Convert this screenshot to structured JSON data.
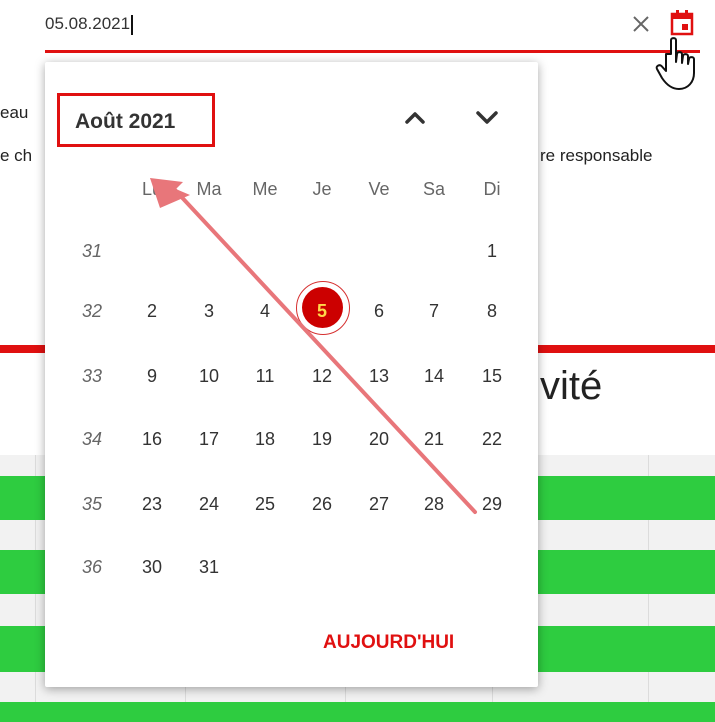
{
  "date_field": {
    "value": "05.08.2021"
  },
  "background": {
    "fragment_1": "eau",
    "fragment_2": "e ch",
    "fragment_3": "re responsable",
    "heading_fragment": "vité"
  },
  "calendar": {
    "month_label": "Août 2021",
    "weekdays": [
      "Lu",
      "Ma",
      "Me",
      "Je",
      "Ve",
      "Sa",
      "Di"
    ],
    "weeks": [
      {
        "number": "31",
        "days": [
          "",
          "",
          "",
          "",
          "",
          "",
          "1"
        ]
      },
      {
        "number": "32",
        "days": [
          "2",
          "3",
          "4",
          "5",
          "6",
          "7",
          "8"
        ]
      },
      {
        "number": "33",
        "days": [
          "9",
          "10",
          "11",
          "12",
          "13",
          "14",
          "15"
        ]
      },
      {
        "number": "34",
        "days": [
          "16",
          "17",
          "18",
          "19",
          "20",
          "21",
          "22"
        ]
      },
      {
        "number": "35",
        "days": [
          "23",
          "24",
          "25",
          "26",
          "27",
          "28",
          "29"
        ]
      },
      {
        "number": "36",
        "days": [
          "30",
          "31",
          "",
          "",
          "",
          "",
          ""
        ]
      }
    ],
    "selected_day": "5",
    "today_button": "AUJOURD'HUI"
  },
  "colors": {
    "accent": "#e01010",
    "selected_fill": "#cc0000",
    "selected_text": "#ffd84a",
    "green_bar": "#2ecc40",
    "annotation_arrow": "#e8767a"
  },
  "icons": {
    "clear": "close-icon",
    "calendar": "calendar-icon",
    "cursor": "hand-pointer-icon",
    "prev": "chevron-up-icon",
    "next": "chevron-down-icon"
  }
}
